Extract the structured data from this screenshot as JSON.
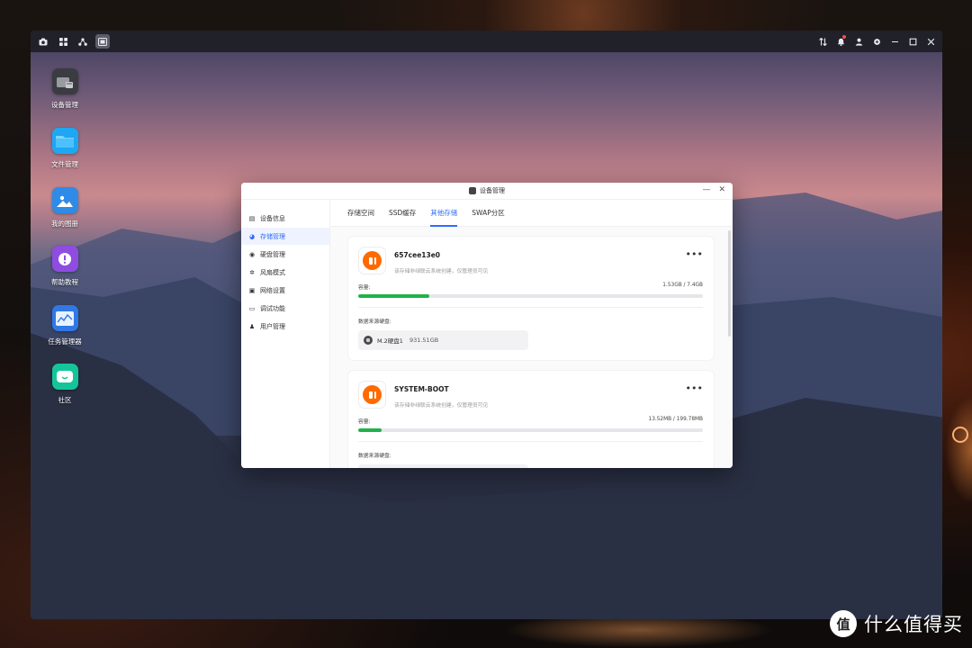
{
  "taskbar": {
    "left_icons": [
      "camera-icon",
      "apps-grid-icon",
      "share-nodes-icon",
      "window-manager-icon"
    ],
    "right_icons": [
      "transfer-icon",
      "notification-bell-icon",
      "user-icon",
      "settings-icon",
      "minimize-icon",
      "maximize-icon",
      "close-icon"
    ]
  },
  "desktop_apps": [
    {
      "label": "设备管理",
      "icon": "device-manager-icon",
      "color": "#3b3b42"
    },
    {
      "label": "文件管理",
      "icon": "folder-icon",
      "color": "#1ea7f2"
    },
    {
      "label": "我的图册",
      "icon": "photo-album-icon",
      "color": "#2e8be8"
    },
    {
      "label": "帮助教程",
      "icon": "help-icon",
      "color": "#8e4de0"
    },
    {
      "label": "任务管理器",
      "icon": "task-manager-icon",
      "color": "#2f78e6"
    },
    {
      "label": "社区",
      "icon": "community-icon",
      "color": "#15c59a"
    }
  ],
  "window": {
    "title": "设备管理",
    "sidebar": [
      {
        "label": "设备信息",
        "icon": "info-icon",
        "active": false
      },
      {
        "label": "存储管理",
        "icon": "storage-icon",
        "active": true
      },
      {
        "label": "硬盘管理",
        "icon": "disk-icon",
        "active": false
      },
      {
        "label": "风扇模式",
        "icon": "fan-icon",
        "active": false
      },
      {
        "label": "网络设置",
        "icon": "network-icon",
        "active": false
      },
      {
        "label": "调试功能",
        "icon": "debug-icon",
        "active": false
      },
      {
        "label": "用户管理",
        "icon": "users-icon",
        "active": false
      }
    ],
    "tabs": [
      {
        "label": "存储空间",
        "active": false
      },
      {
        "label": "SSD缓存",
        "active": false
      },
      {
        "label": "其他存储",
        "active": true
      },
      {
        "label": "SWAP分区",
        "active": false
      }
    ],
    "cards": [
      {
        "name": "657cee13e0",
        "desc": "该存储非绿联云系统创建，仅管理员可见",
        "capacity_label": "容量:",
        "capacity_value": "1.53GB / 7.4GB",
        "usage_fraction": 0.207,
        "source_label": "数据来源硬盘:",
        "source_disk": "M.2硬盘1",
        "source_size": "931.51GB"
      },
      {
        "name": "SYSTEM-BOOT",
        "desc": "该存储非绿联云系统创建，仅管理员可见",
        "capacity_label": "容量:",
        "capacity_value": "13.52MB / 199.78MB",
        "usage_fraction": 0.068,
        "source_label": "数据来源硬盘:",
        "source_disk": "",
        "source_size": ""
      }
    ]
  },
  "watermark": {
    "badge": "值",
    "text": "什么值得买"
  },
  "colors": {
    "accent": "#2f6bff",
    "progress": "#1fb34a",
    "disk_orange": "#ff6a00"
  }
}
